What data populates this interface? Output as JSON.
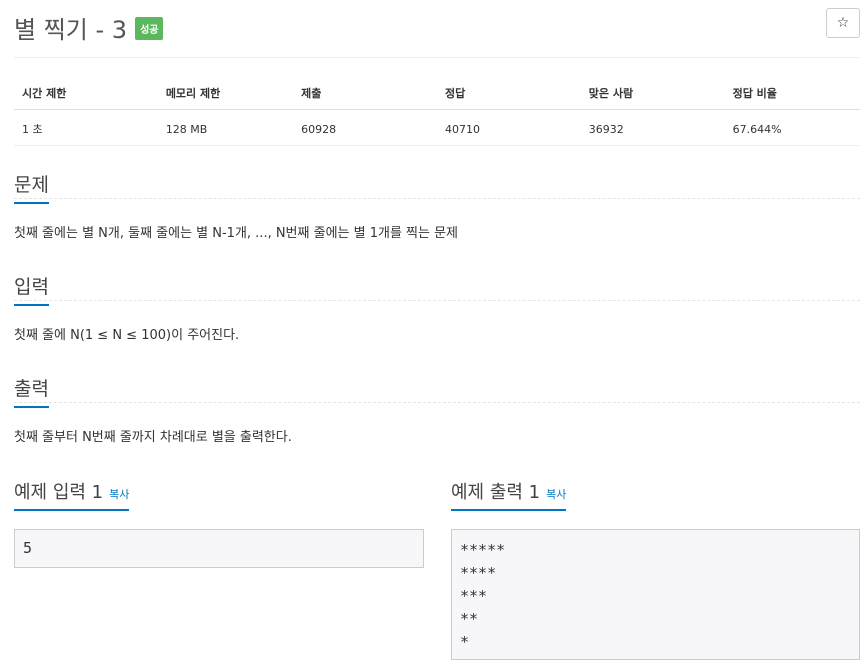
{
  "header": {
    "title": "별 찍기 - 3",
    "badge": "성공",
    "star": "☆"
  },
  "info": {
    "columns": [
      "시간 제한",
      "메모리 제한",
      "제출",
      "정답",
      "맞은 사람",
      "정답 비율"
    ],
    "values": [
      "1 초",
      "128 MB",
      "60928",
      "40710",
      "36932",
      "67.644%"
    ]
  },
  "problem": {
    "title": "문제",
    "text": "첫째 줄에는 별 N개, 둘째 줄에는 별 N-1개, ..., N번째 줄에는 별 1개를 찍는 문제"
  },
  "input": {
    "title": "입력",
    "text": "첫째 줄에 N(1 ≤ N ≤ 100)이 주어진다."
  },
  "output": {
    "title": "출력",
    "text": "첫째 줄부터 N번째 줄까지 차례대로 별을 출력한다."
  },
  "sample_input": {
    "title": "예제 입력 1",
    "copy": "복사",
    "content": "5"
  },
  "sample_output": {
    "title": "예제 출력 1",
    "copy": "복사",
    "content": "*****\n****\n***\n**\n*"
  }
}
